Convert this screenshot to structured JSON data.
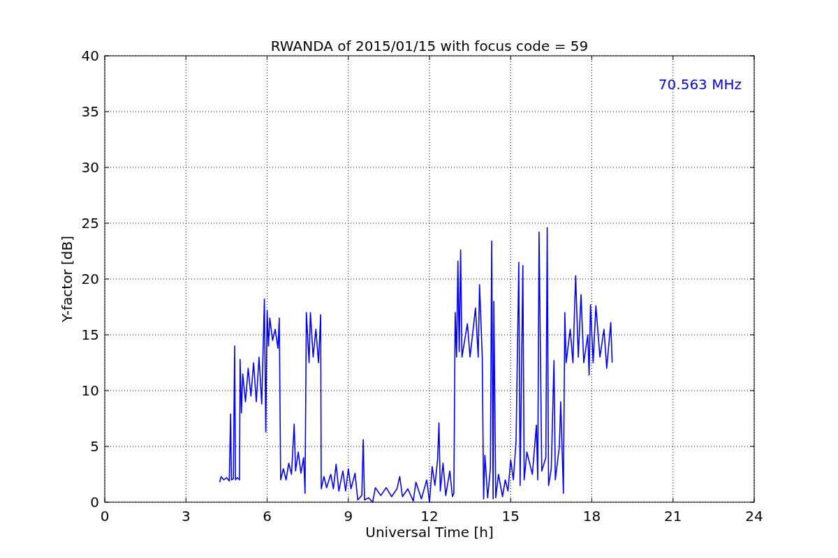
{
  "chart_data": {
    "type": "line",
    "title": "RWANDA of 2015/01/15 with focus code = 59",
    "xlabel": "Universal Time [h]",
    "ylabel": "Y-factor [dB]",
    "xlim": [
      0,
      24
    ],
    "ylim": [
      0,
      40
    ],
    "xticks": [
      0,
      3,
      6,
      9,
      12,
      15,
      18,
      21,
      24
    ],
    "yticks": [
      0,
      5,
      10,
      15,
      20,
      25,
      30,
      35,
      40
    ],
    "x": [
      4.25,
      4.3,
      4.4,
      4.5,
      4.6,
      4.65,
      4.68,
      4.75,
      4.8,
      4.83,
      4.9,
      4.98,
      5.0,
      5.05,
      5.1,
      5.2,
      5.3,
      5.4,
      5.5,
      5.6,
      5.7,
      5.8,
      5.9,
      5.95,
      6.0,
      6.05,
      6.1,
      6.2,
      6.3,
      6.4,
      6.45,
      6.5,
      6.6,
      6.7,
      6.8,
      6.9,
      7.0,
      7.05,
      7.15,
      7.25,
      7.35,
      7.4,
      7.45,
      7.55,
      7.6,
      7.7,
      7.8,
      7.9,
      7.98,
      8.0,
      8.1,
      8.2,
      8.35,
      8.45,
      8.55,
      8.65,
      8.8,
      8.9,
      9.0,
      9.1,
      9.25,
      9.35,
      9.5,
      9.55,
      9.6,
      9.75,
      9.9,
      10.0,
      10.2,
      10.4,
      10.6,
      10.8,
      10.9,
      11.0,
      11.2,
      11.4,
      11.5,
      11.7,
      11.9,
      12.0,
      12.1,
      12.2,
      12.3,
      12.35,
      12.4,
      12.5,
      12.6,
      12.75,
      12.85,
      12.9,
      12.95,
      13.0,
      13.05,
      13.1,
      13.15,
      13.2,
      13.4,
      13.5,
      13.7,
      13.8,
      13.85,
      13.95,
      14.0,
      14.05,
      14.15,
      14.25,
      14.3,
      14.35,
      14.38,
      14.45,
      14.55,
      14.7,
      14.8,
      14.9,
      15.0,
      15.1,
      15.2,
      15.3,
      15.35,
      15.45,
      15.5,
      15.6,
      15.8,
      15.95,
      16.0,
      16.05,
      16.15,
      16.3,
      16.35,
      16.4,
      16.5,
      16.6,
      16.65,
      16.8,
      16.85,
      16.95,
      17.0,
      17.05,
      17.2,
      17.3,
      17.4,
      17.5,
      17.6,
      17.7,
      17.85,
      17.9,
      17.95,
      18.05,
      18.15,
      18.3,
      18.45,
      18.55,
      18.7,
      18.75
    ],
    "grid": true,
    "series": [
      {
        "name": "70.563 MHz",
        "color": "#0000ff",
        "values": [
          1.8,
          2.3,
          2.0,
          2.2,
          1.9,
          7.9,
          2.0,
          2.1,
          14.0,
          2.0,
          2.2,
          2.0,
          12.8,
          8.0,
          11.5,
          9.0,
          12.0,
          9.5,
          12.5,
          9.0,
          13.0,
          8.8,
          18.2,
          6.3,
          17.2,
          14.0,
          16.5,
          14.5,
          15.5,
          13.8,
          16.5,
          2.0,
          3.0,
          2.0,
          3.5,
          2.5,
          7.0,
          2.8,
          4.5,
          2.6,
          4.0,
          0.8,
          17.0,
          12.5,
          17.0,
          13.0,
          15.5,
          12.5,
          16.8,
          1.2,
          2.3,
          1.3,
          2.5,
          1.2,
          3.4,
          1.0,
          2.8,
          1.0,
          3.0,
          1.2,
          2.6,
          0.2,
          0.6,
          5.6,
          0.2,
          0.4,
          0.0,
          1.3,
          0.6,
          1.3,
          0.5,
          1.2,
          2.3,
          0.5,
          1.2,
          0.1,
          1.8,
          0.3,
          2.0,
          0.0,
          3.2,
          1.5,
          3.8,
          7.1,
          1.0,
          3.5,
          0.6,
          2.8,
          0.5,
          0.8,
          17.0,
          13.0,
          21.6,
          13.5,
          22.6,
          13.0,
          16.0,
          13.0,
          17.4,
          13.0,
          19.5,
          13.0,
          0.3,
          4.2,
          0.4,
          3.0,
          23.4,
          0.3,
          18.0,
          0.4,
          2.5,
          0.5,
          2.0,
          1.0,
          3.8,
          2.0,
          5.5,
          21.5,
          1.5,
          21.2,
          2.0,
          4.5,
          2.5,
          6.9,
          2.0,
          24.2,
          2.8,
          4.0,
          24.6,
          1.5,
          3.0,
          12.7,
          2.0,
          5.0,
          9.0,
          0.8,
          17.0,
          12.5,
          15.5,
          12.5,
          20.3,
          13.0,
          18.6,
          12.5,
          15.0,
          11.4,
          17.7,
          12.5,
          17.6,
          13.0,
          15.5,
          12.0,
          16.1,
          12.5
        ]
      }
    ]
  }
}
